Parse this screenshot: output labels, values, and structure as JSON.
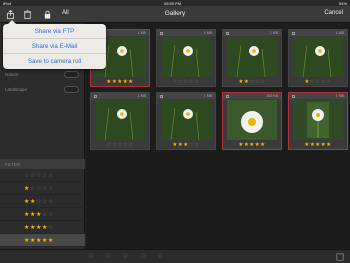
{
  "status_bar": {
    "device": "iPod",
    "time": "09:55 PM",
    "battery": "54%"
  },
  "nav": {
    "title": "Gallery",
    "cancel_label": "Cancel",
    "all_label": "All"
  },
  "share_menu": [
    "Share via FTP",
    "Share via E-Mail",
    "Save to camera roll"
  ],
  "sidebar": {
    "rows": [
      {
        "label": "Nature"
      },
      {
        "label": "Landscape"
      }
    ],
    "filter_title": "FILTER",
    "filter_ratings": [
      0,
      1,
      2,
      3,
      4,
      5
    ]
  },
  "thumbnails": [
    {
      "size": "1 MB",
      "rating": 5,
      "selected": true,
      "subject": "daisy-small"
    },
    {
      "size": "1 MB",
      "rating": 0,
      "selected": false,
      "subject": "daisy-small"
    },
    {
      "size": "1 MB",
      "rating": 2,
      "selected": false,
      "subject": "daisy-small"
    },
    {
      "size": "1 MB",
      "rating": 1,
      "selected": false,
      "subject": "daisy-small"
    },
    {
      "size": "1 MB",
      "rating": 0,
      "selected": false,
      "subject": "daisy-small"
    },
    {
      "size": "1 MB",
      "rating": 3,
      "selected": false,
      "subject": "daisy-small"
    },
    {
      "size": "352 KB",
      "rating": 5,
      "selected": true,
      "subject": "daisy-large"
    },
    {
      "size": "1 MB",
      "rating": 5,
      "selected": true,
      "subject": "daisy-portrait"
    }
  ],
  "colors": {
    "star_on": "#f4c000",
    "star_off": "#6a6a6a",
    "selection": "#b5313a",
    "link_blue": "#2f6cd8"
  },
  "icons": [
    "share-icon",
    "trash-icon",
    "lock-icon",
    "expand-icon"
  ]
}
